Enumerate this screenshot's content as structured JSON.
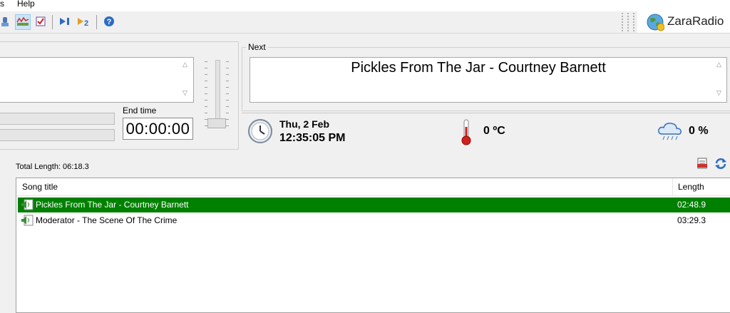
{
  "menu": {
    "items": [
      "s",
      "Help"
    ]
  },
  "toolbar": {
    "buttons": [
      "profile-icon",
      "spectrum-icon",
      "checklist-icon",
      "play-next-1-icon",
      "play-next-2-icon",
      "help-icon"
    ],
    "logo_text": "ZaraRadio"
  },
  "left_panel": {
    "end_time_label": "End time",
    "end_time_value": "00:00:00"
  },
  "next_panel": {
    "label": "Next",
    "track": "Pickles From The Jar - Courtney Barnett"
  },
  "info": {
    "date": "Thu, 2 Feb",
    "time": "12:35:05 PM",
    "temperature": "0 ºC",
    "rain": "0 %"
  },
  "playlist": {
    "total_length": "Total Length: 06:18.3",
    "columns": {
      "title": "Song title",
      "length": "Length"
    },
    "rows": [
      {
        "title": "Pickles From The Jar - Courtney Barnett",
        "length": "02:48.9",
        "selected": true
      },
      {
        "title": "Moderator - The Scene Of The Crime",
        "length": "03:29.3",
        "selected": false
      }
    ]
  },
  "colors": {
    "selected_row": "#008000",
    "accent": "#2b6cc4"
  }
}
